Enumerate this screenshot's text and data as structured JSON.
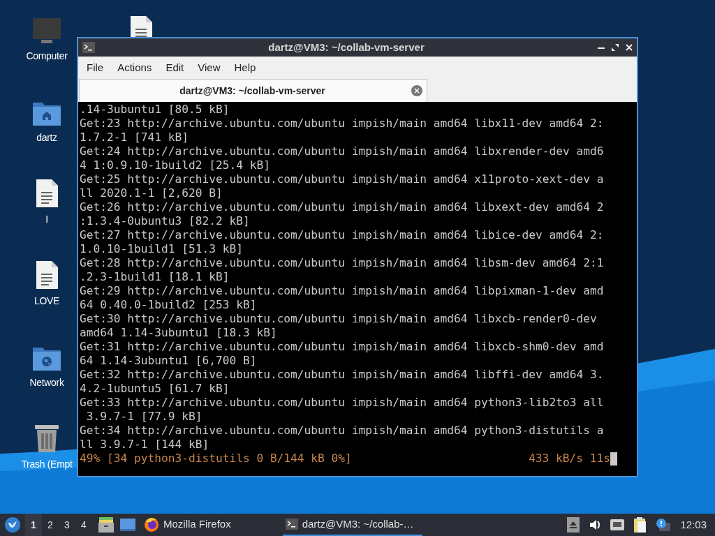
{
  "desktop_icons": [
    {
      "kind": "computer",
      "label": "Computer"
    },
    {
      "kind": "home-folder",
      "label": "dartz"
    },
    {
      "kind": "document",
      "label": "I"
    },
    {
      "kind": "document",
      "label": "LOVE"
    },
    {
      "kind": "network-folder",
      "label": "Network"
    },
    {
      "kind": "trash",
      "label": "Trash (Empt"
    }
  ],
  "partial_icons": [
    {
      "kind": "document"
    }
  ],
  "window": {
    "title": "dartz@VM3: ~/collab-vm-server",
    "menu": [
      "File",
      "Actions",
      "Edit",
      "View",
      "Help"
    ],
    "tabs": [
      {
        "label": "dartz@VM3: ~/collab-vm-server",
        "selected": true
      }
    ],
    "lines": [
      ".14-3ubuntu1 [80.5 kB]",
      "Get:23 http://archive.ubuntu.com/ubuntu impish/main amd64 libx11-dev amd64 2:",
      "1.7.2-1 [741 kB]",
      "Get:24 http://archive.ubuntu.com/ubuntu impish/main amd64 libxrender-dev amd6",
      "4 1:0.9.10-1build2 [25.4 kB]",
      "Get:25 http://archive.ubuntu.com/ubuntu impish/main amd64 x11proto-xext-dev a",
      "ll 2020.1-1 [2,620 B]",
      "Get:26 http://archive.ubuntu.com/ubuntu impish/main amd64 libxext-dev amd64 2",
      ":1.3.4-0ubuntu3 [82.2 kB]",
      "Get:27 http://archive.ubuntu.com/ubuntu impish/main amd64 libice-dev amd64 2:",
      "1.0.10-1build1 [51.3 kB]",
      "Get:28 http://archive.ubuntu.com/ubuntu impish/main amd64 libsm-dev amd64 2:1",
      ".2.3-1build1 [18.1 kB]",
      "Get:29 http://archive.ubuntu.com/ubuntu impish/main amd64 libpixman-1-dev amd",
      "64 0.40.0-1build2 [253 kB]",
      "Get:30 http://archive.ubuntu.com/ubuntu impish/main amd64 libxcb-render0-dev",
      "amd64 1.14-3ubuntu1 [18.3 kB]",
      "Get:31 http://archive.ubuntu.com/ubuntu impish/main amd64 libxcb-shm0-dev amd",
      "64 1.14-3ubuntu1 [6,700 B]",
      "Get:32 http://archive.ubuntu.com/ubuntu impish/main amd64 libffi-dev amd64 3.",
      "4.2-1ubuntu5 [61.7 kB]",
      "Get:33 http://archive.ubuntu.com/ubuntu impish/main amd64 python3-lib2to3 all",
      " 3.9.7-1 [77.9 kB]",
      "Get:34 http://archive.ubuntu.com/ubuntu impish/main amd64 python3-distutils a",
      "ll 3.9.7-1 [144 kB]"
    ],
    "progress": "49% [34 python3-distutils 0 B/144 kB 0%]",
    "rate": "433 kB/s 11s"
  },
  "taskbar": {
    "workspaces": [
      {
        "label": "1",
        "selected": true
      },
      {
        "label": "2",
        "selected": false
      },
      {
        "label": "3",
        "selected": false
      },
      {
        "label": "4",
        "selected": false
      }
    ],
    "launchers": [
      {
        "kind": "file-manager"
      },
      {
        "kind": "desktop"
      }
    ],
    "tasks": [
      {
        "kind": "firefox",
        "label": "Mozilla Firefox",
        "selected": false
      },
      {
        "kind": "terminal",
        "label": "dartz@VM3: ~/collab-…",
        "selected": true
      }
    ],
    "tray": [
      {
        "kind": "eject"
      },
      {
        "kind": "volume"
      },
      {
        "kind": "network"
      },
      {
        "kind": "clipboard"
      },
      {
        "kind": "notification"
      }
    ],
    "clock": "12:03"
  }
}
